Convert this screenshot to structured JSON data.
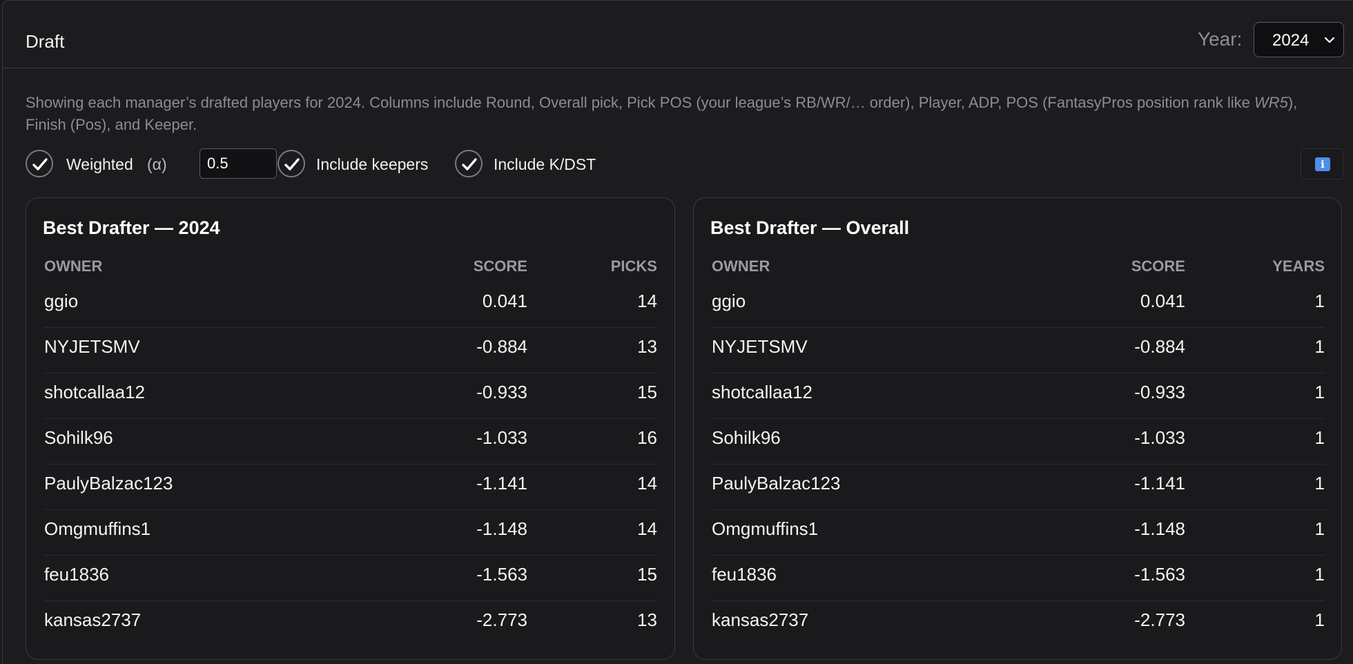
{
  "header": {
    "title": "Draft",
    "year_label": "Year:",
    "year_value": "2024"
  },
  "description": {
    "part1": "Showing each manager’s drafted players for 2024. Columns include Round, Overall pick, Pick POS (your league’s RB/WR/… order), Player, ADP, POS (FantasyPros position rank like ",
    "emph": "WR5",
    "part2": "), Finish (Pos), and Keeper."
  },
  "options": {
    "weighted_label": "Weighted",
    "alpha_label": "(α)",
    "alpha_value": "0.5",
    "weighted_checked": true,
    "keepers_label": "Include keepers",
    "keepers_checked": true,
    "kdst_label": "Include K/DST",
    "kdst_checked": true,
    "info_icon": "info-icon"
  },
  "colors": {
    "background": "#1c1c1f",
    "accent": "#4d8ee8",
    "muted_text": "#8c8c91"
  },
  "season_card": {
    "title": "Best Drafter — 2024",
    "columns": [
      "OWNER",
      "SCORE",
      "PICKS"
    ],
    "rows": [
      {
        "owner": "ggio",
        "score": "0.041",
        "count": "14"
      },
      {
        "owner": "NYJETSMV",
        "score": "-0.884",
        "count": "13"
      },
      {
        "owner": "shotcallaa12",
        "score": "-0.933",
        "count": "15"
      },
      {
        "owner": "Sohilk96",
        "score": "-1.033",
        "count": "16"
      },
      {
        "owner": "PaulyBalzac123",
        "score": "-1.141",
        "count": "14"
      },
      {
        "owner": "Omgmuffins1",
        "score": "-1.148",
        "count": "14"
      },
      {
        "owner": "feu1836",
        "score": "-1.563",
        "count": "15"
      },
      {
        "owner": "kansas2737",
        "score": "-2.773",
        "count": "13"
      }
    ]
  },
  "overall_card": {
    "title": "Best Drafter — Overall",
    "columns": [
      "OWNER",
      "SCORE",
      "YEARS"
    ],
    "rows": [
      {
        "owner": "ggio",
        "score": "0.041",
        "count": "1"
      },
      {
        "owner": "NYJETSMV",
        "score": "-0.884",
        "count": "1"
      },
      {
        "owner": "shotcallaa12",
        "score": "-0.933",
        "count": "1"
      },
      {
        "owner": "Sohilk96",
        "score": "-1.033",
        "count": "1"
      },
      {
        "owner": "PaulyBalzac123",
        "score": "-1.141",
        "count": "1"
      },
      {
        "owner": "Omgmuffins1",
        "score": "-1.148",
        "count": "1"
      },
      {
        "owner": "feu1836",
        "score": "-1.563",
        "count": "1"
      },
      {
        "owner": "kansas2737",
        "score": "-2.773",
        "count": "1"
      }
    ]
  }
}
